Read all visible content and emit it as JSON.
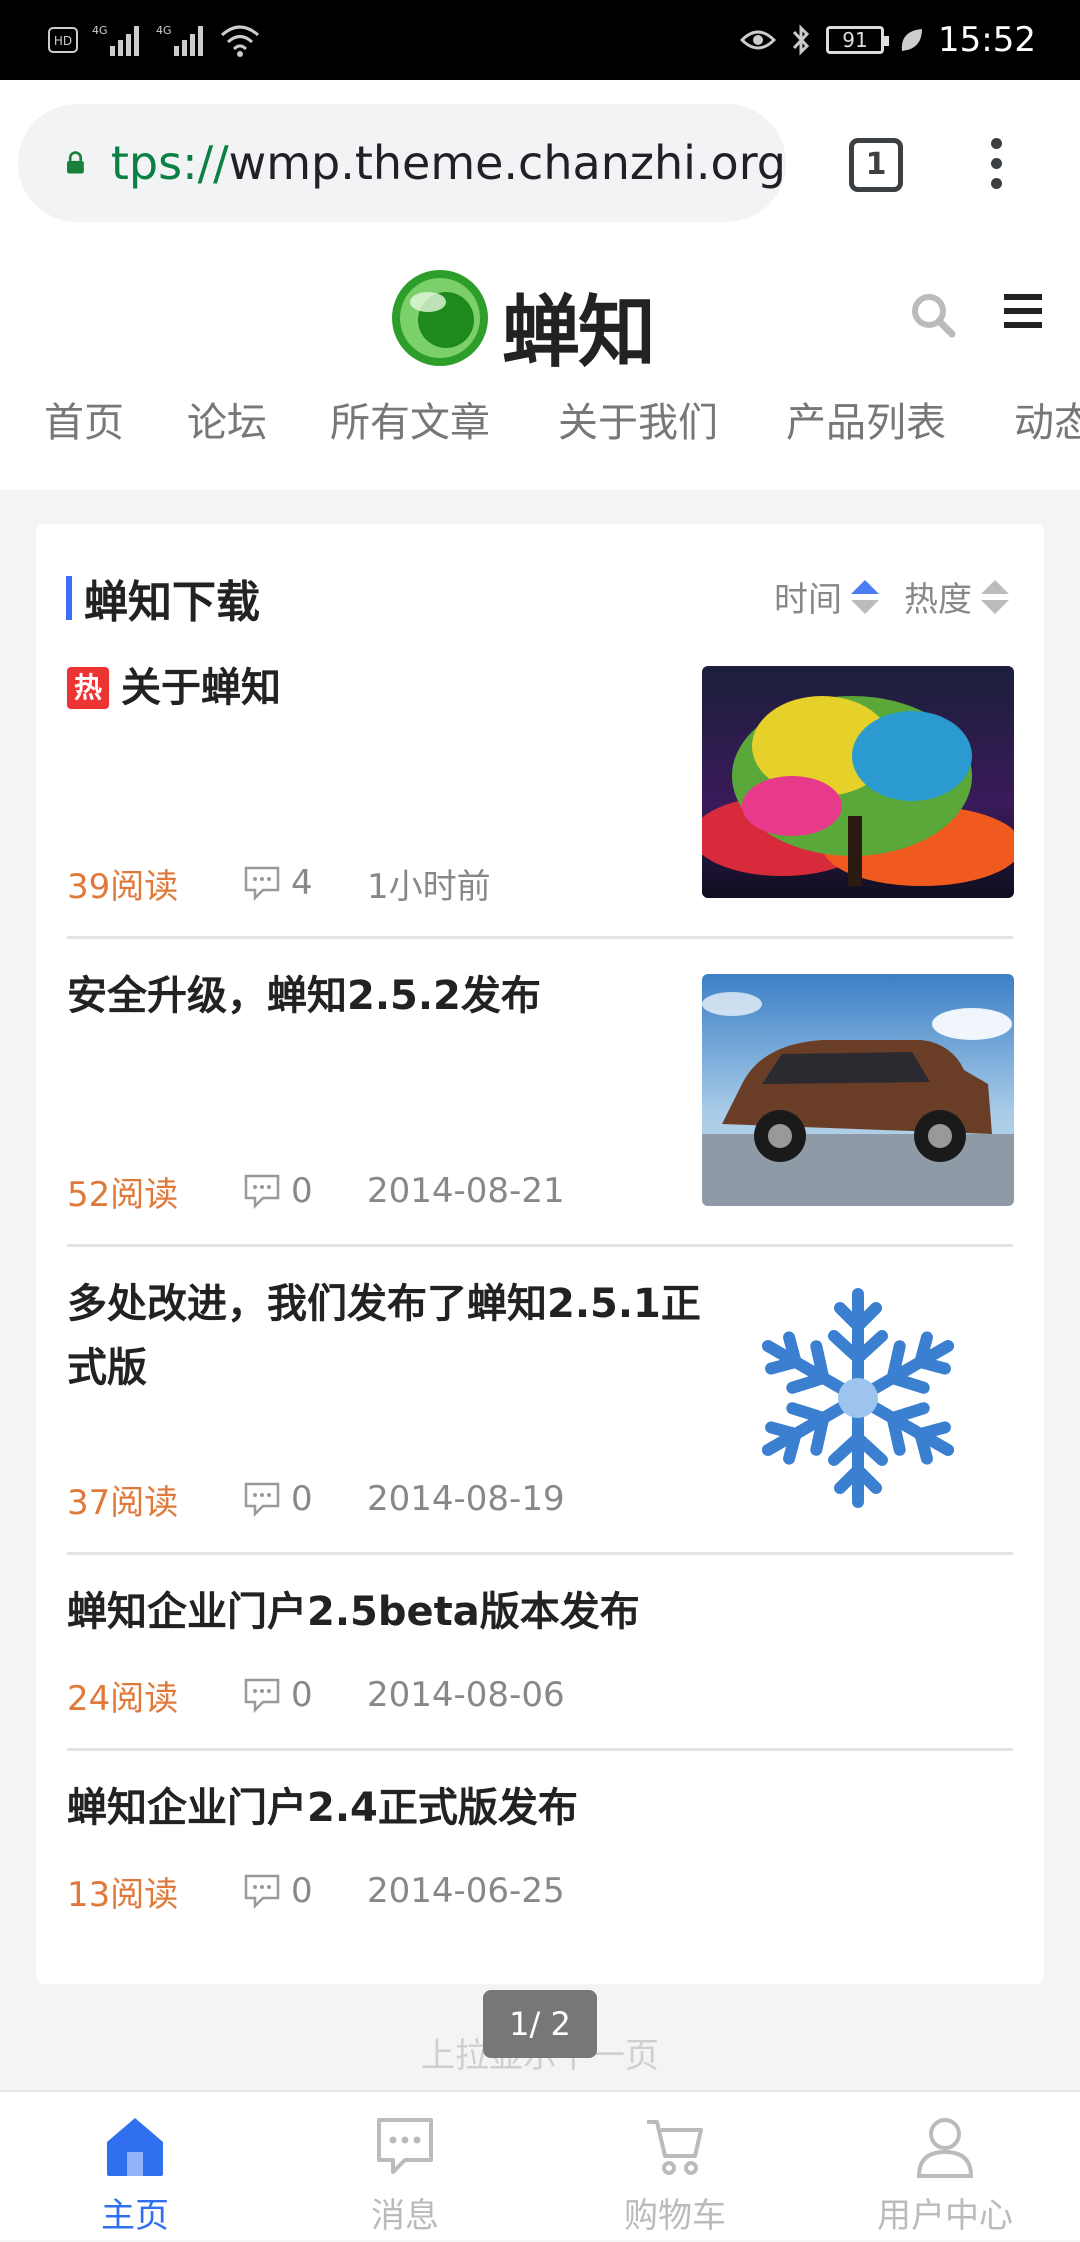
{
  "status_bar": {
    "left_icons": [
      "hd-icon",
      "signal-4g-icon",
      "signal-4g-icon",
      "wifi-icon"
    ],
    "right_icons": [
      "eye-icon",
      "bluetooth-icon",
      "battery-icon",
      "leaf-icon"
    ],
    "battery": "91",
    "time": "15:52"
  },
  "browser": {
    "url_scheme": "tps://",
    "url_host": "wmp.theme.chanzhi.org",
    "tab_count": "1"
  },
  "site": {
    "logo_text": "蝉知",
    "nav": [
      "首页",
      "论坛",
      "所有文章",
      "关于我们",
      "产品列表",
      "动态"
    ]
  },
  "section": {
    "title": "蝉知下载",
    "sort_time": "时间",
    "sort_hot": "热度"
  },
  "articles": [
    {
      "hot_badge": "热",
      "title": "关于蝉知",
      "reads": "39阅读",
      "comments": "4",
      "date": "1小时前",
      "thumb": "tree"
    },
    {
      "title": "安全升级，蝉知2.5.2发布",
      "reads": "52阅读",
      "comments": "0",
      "date": "2014-08-21",
      "thumb": "car"
    },
    {
      "title": "多处改进，我们发布了蝉知2.5.1正式版",
      "reads": "37阅读",
      "comments": "0",
      "date": "2014-08-19",
      "thumb": "snowflake"
    },
    {
      "title": "蝉知企业门户2.5beta版本发布",
      "reads": "24阅读",
      "comments": "0",
      "date": "2014-08-06"
    },
    {
      "title": "蝉知企业门户2.4正式版发布",
      "reads": "13阅读",
      "comments": "0",
      "date": "2014-06-25"
    }
  ],
  "pager": {
    "page": "1/ 2",
    "hint": "上拉显示下一页"
  },
  "tabbar": {
    "items": [
      {
        "label": "主页",
        "icon": "home-icon",
        "active": true
      },
      {
        "label": "消息",
        "icon": "message-icon"
      },
      {
        "label": "购物车",
        "icon": "cart-icon"
      },
      {
        "label": "用户中心",
        "icon": "user-icon"
      }
    ]
  },
  "colors": {
    "accent": "#2f6ff0",
    "reads": "#e07a3c",
    "hot": "#ee3333"
  }
}
